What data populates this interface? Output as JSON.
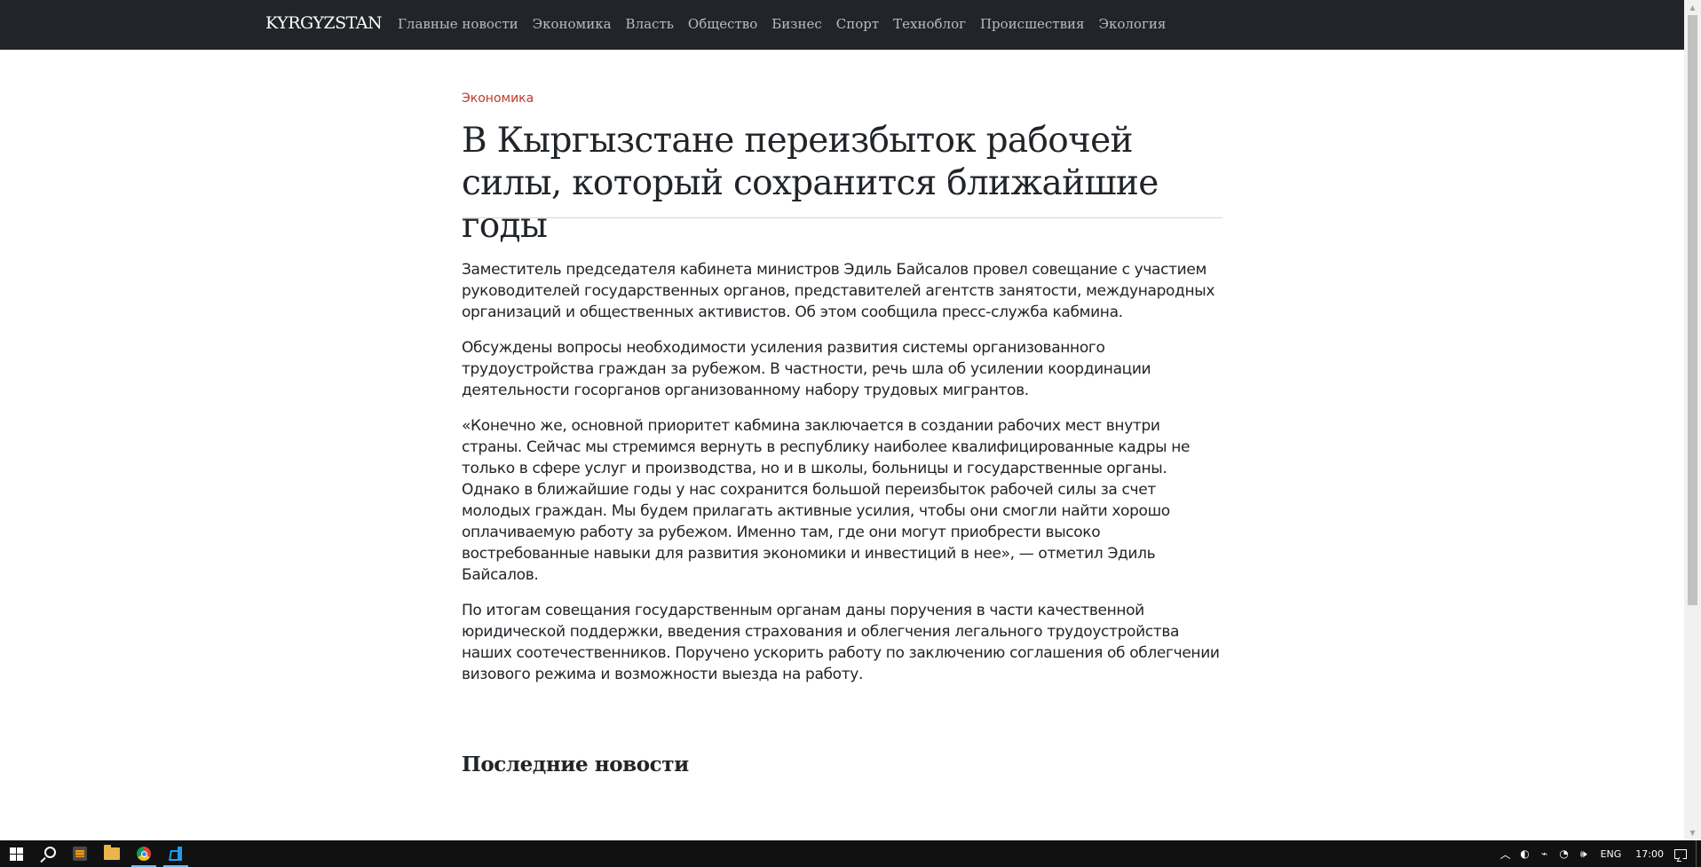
{
  "nav": {
    "brand": "KYRGYZSTAN",
    "links": [
      "Главные новости",
      "Экономика",
      "Власть",
      "Общество",
      "Бизнес",
      "Спорт",
      "Техноблог",
      "Происшествия",
      "Экология"
    ]
  },
  "article": {
    "category": "Экономика",
    "title": "В Кыргызстане переизбыток рабочей силы, который сохранится ближайшие годы",
    "paragraphs": [
      "Заместитель председателя кабинета министров Эдиль Байсалов провел совещание с участием руководителей государственных органов, представителей агентств занятости, международных организаций и общественных активистов. Об этом сообщила пресс-служба кабмина.",
      "Обсуждены вопросы необходимости усиления развития системы организованного трудоустройства граждан за рубежом. В частности, речь шла об усилении координации деятельности госорганов организованному набору трудовых мигрантов.",
      "«Конечно же, основной приоритет кабмина заключается в создании рабочих мест внутри страны. Сейчас мы стремимся вернуть в республику наиболее квалифицированные кадры не только в сфере услуг и производства, но и в школы, больницы и государственные органы. Однако в ближайшие годы у нас сохранится большой переизбыток рабочей силы за счет молодых граждан. Мы будем прилагать активные усилия, чтобы они смогли найти хорошо оплачиваемую работу за рубежом. Именно там, где они могут приобрести высоко востребованные навыки для развития экономики и инвестиций в нее», — отметил Эдиль Байсалов.",
      "По итогам совещания государственным органам даны поручения в части качественной юридической поддержки, введения страхования и облегчения легального трудоустройства наших соотечественников. Поручено ускорить работу по заключению соглашения об облегчении визового режима и возможности выезда на работу."
    ]
  },
  "latest_news": {
    "heading": "Последние новости"
  },
  "taskbar": {
    "apps": [
      "windows-start-icon",
      "search-icon",
      "sublime-text-icon",
      "file-explorer-icon",
      "chrome-icon",
      "vscode-icon"
    ],
    "active_app": "chrome-icon",
    "tray": {
      "language": "ENG",
      "time": "17:00"
    }
  }
}
